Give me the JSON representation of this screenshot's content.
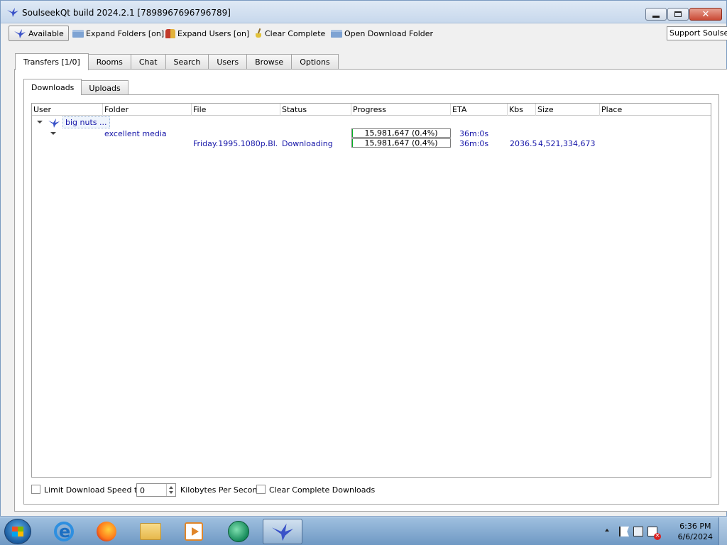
{
  "window": {
    "title": "SoulseekQt build 2024.2.1 [7898967696796789]"
  },
  "toolbar": {
    "available_label": "Available",
    "expand_folders_label": "Expand Folders [on]",
    "expand_users_label": "Expand Users [on]",
    "clear_complete_label": "Clear Complete",
    "open_download_folder_label": "Open Download Folder",
    "support_label": "Support Soulseek"
  },
  "main_tabs": [
    "Transfers [1/0]",
    "Rooms",
    "Chat",
    "Search",
    "Users",
    "Browse",
    "Options"
  ],
  "sub_tabs": [
    "Downloads",
    "Uploads"
  ],
  "table": {
    "columns": [
      "User",
      "Folder",
      "File",
      "Status",
      "Progress",
      "ETA",
      "Kbs",
      "Size",
      "Place"
    ],
    "user": "big nuts ...",
    "folder": {
      "name": "excellent media",
      "progress_text": "15,981,647 (0.4%)",
      "progress_fraction": 0.004,
      "eta": "36m:0s"
    },
    "file": {
      "name": "Friday.1995.1080p.Bl...",
      "status": "Downloading",
      "progress_text": "15,981,647 (0.4%)",
      "progress_fraction": 0.004,
      "eta": "36m:0s",
      "kbs": "2036.5",
      "size": "4,521,334,673",
      "place": ""
    }
  },
  "bottom": {
    "limit_label": "Limit Download Speed to",
    "limit_value": "0",
    "limit_checked": false,
    "unit_label": "Kilobytes Per Second",
    "clear_label": "Clear Complete Downloads",
    "clear_checked": false
  },
  "taskbar": {
    "time": "6:36 PM",
    "date": "6/6/2024"
  },
  "colors": {
    "link_text": "#1515a8",
    "progress_fill": "#06b025",
    "taskbar": "#6f99c4"
  }
}
